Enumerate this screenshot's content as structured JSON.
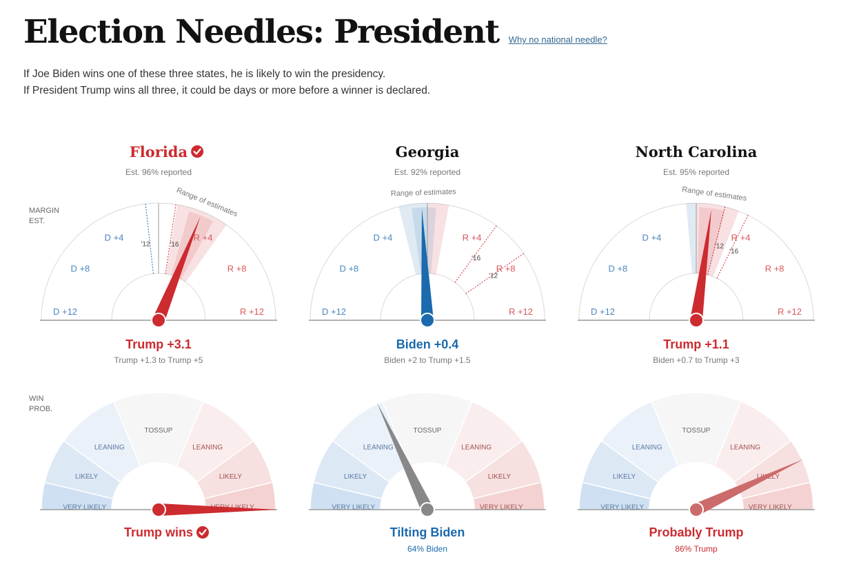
{
  "page": {
    "title": "Election Needles: President",
    "why_link": "Why no national needle?",
    "intro_line1": "If Joe Biden wins one of these three states, he is likely to win the presidency.",
    "intro_line2": "If President Trump wins all three, it could be days or more before a winner is declared."
  },
  "labels": {
    "margin_row": [
      "MARGIN",
      "EST."
    ],
    "win_row": [
      "WIN",
      "PROB."
    ],
    "range_label": "Range of estimates",
    "margin_ticks": [
      "D +12",
      "D +8",
      "D +4",
      "R +4",
      "R +8",
      "R +12"
    ],
    "win_bands": [
      "VERY LIKELY",
      "LIKELY",
      "LEANING",
      "TOSSUP",
      "LEANING",
      "LIKELY",
      "VERY LIKELY"
    ]
  },
  "colors": {
    "dem": "#1a6aad",
    "dem_text": "#4a86c0",
    "rep": "#cc2b30",
    "rep_text": "#d9595c",
    "rep_light": "#cc6b6b",
    "neutral": "#888888",
    "band_vl_d": "#cfe0f2",
    "band_l_d": "#dde8f5",
    "band_lean_d": "#eaf1f9",
    "band_toss": "#f6f6f6",
    "band_lean_r": "#faeded",
    "band_l_r": "#f7e0e0",
    "band_vl_r": "#f4d2d2"
  },
  "chart_data": [
    {
      "type": "gauge",
      "state": "Florida",
      "called": true,
      "reported": "Est. 96% reported",
      "margin": {
        "value": 3.1,
        "label": "Trump +3.1",
        "range": [
          1.3,
          5
        ],
        "range_label": "Trump +1.3 to Trump +5",
        "history": [
          {
            "label": "'12",
            "value": -0.9
          },
          {
            "label": "'16",
            "value": 1.2
          }
        ]
      },
      "win": {
        "probability_trump": 100,
        "label": "Trump wins",
        "sublabel": ""
      }
    },
    {
      "type": "gauge",
      "state": "Georgia",
      "called": false,
      "reported": "Est. 92% reported",
      "margin": {
        "value": -0.4,
        "label": "Biden +0.4",
        "range": [
          -2,
          1.5
        ],
        "range_label": "Biden +2 to Trump +1.5",
        "history": [
          {
            "label": "'16",
            "value": 5.1
          },
          {
            "label": "'12",
            "value": 7.8
          }
        ]
      },
      "win": {
        "probability_trump": 36,
        "label": "Tilting Biden",
        "sublabel": "64% Biden"
      }
    },
    {
      "type": "gauge",
      "state": "North Carolina",
      "called": false,
      "reported": "Est. 95% reported",
      "margin": {
        "value": 1.1,
        "label": "Trump +1.1",
        "range": [
          -0.7,
          3
        ],
        "range_label": "Biden +0.7 to Trump +3",
        "history": [
          {
            "label": "'12",
            "value": 2.0
          },
          {
            "label": "'16",
            "value": 3.7
          }
        ]
      },
      "win": {
        "probability_trump": 86,
        "label": "Probably Trump",
        "sublabel": "86% Trump"
      }
    }
  ]
}
